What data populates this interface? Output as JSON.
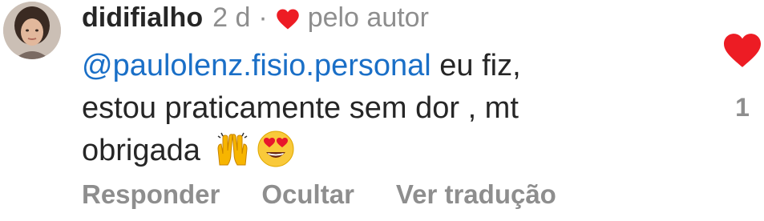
{
  "comment": {
    "username": "didifialho",
    "time": "2 d",
    "separator": "·",
    "author_like_label": "pelo autor",
    "mention": "@paulolenz.fisio.personal",
    "text_line1": " eu fiz,",
    "text_line2": "estou praticamente sem dor , mt",
    "text_line3": "obrigada ",
    "like_count": "1",
    "heart_color": "#ed1c24"
  },
  "actions": {
    "reply": "Responder",
    "hide": "Ocultar",
    "translate": "Ver tradução"
  },
  "icons": [
    "heart-icon",
    "raised-hands-emoji",
    "heart-eyes-emoji"
  ]
}
